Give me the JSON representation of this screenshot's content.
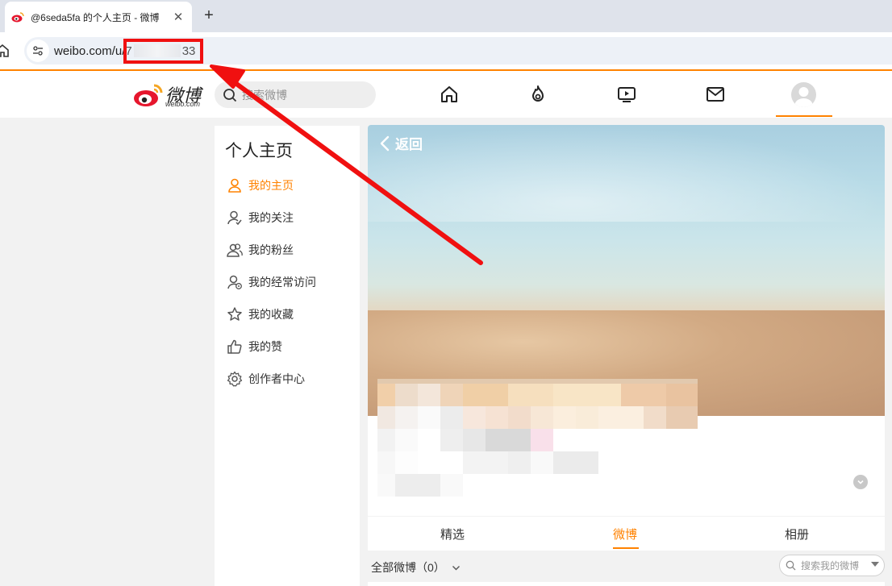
{
  "browser": {
    "tab_title": "@6seda5fa 的个人主页 - 微博",
    "tab_close": "✕",
    "new_tab": "+",
    "url_prefix": "weibo.com/u/",
    "url_visible_start": "7",
    "url_visible_end": "33"
  },
  "header": {
    "logo_text": "微博",
    "logo_sub": "weibo.com",
    "search_placeholder": "搜索微博",
    "nav_icons": [
      "home-icon",
      "hot-fire-icon",
      "video-icon",
      "mail-icon",
      "avatar"
    ]
  },
  "sidebar": {
    "title": "个人主页",
    "items": [
      {
        "label": "我的主页",
        "icon": "user-icon",
        "active": true
      },
      {
        "label": "我的关注",
        "icon": "user-follow-icon",
        "active": false
      },
      {
        "label": "我的粉丝",
        "icon": "users-fans-icon",
        "active": false
      },
      {
        "label": "我的经常访问",
        "icon": "user-visit-icon",
        "active": false
      },
      {
        "label": "我的收藏",
        "icon": "star-icon",
        "active": false
      },
      {
        "label": "我的赞",
        "icon": "thumbs-up-icon",
        "active": false
      },
      {
        "label": "创作者中心",
        "icon": "gear-icon",
        "active": false
      }
    ]
  },
  "profile": {
    "back_label": "返回"
  },
  "tabs": [
    {
      "label": "精选",
      "active": false
    },
    {
      "label": "微博",
      "active": true
    },
    {
      "label": "相册",
      "active": false
    }
  ],
  "filter": {
    "all_label": "全部微博",
    "count": "（0）",
    "search_placeholder": "搜索我的微博"
  },
  "colors": {
    "accent": "#ff8200",
    "annotation": "#f01010"
  }
}
